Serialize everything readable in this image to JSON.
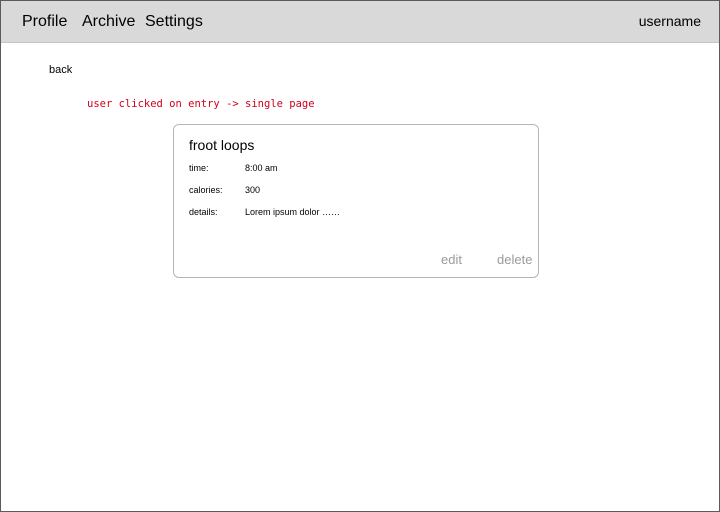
{
  "nav": {
    "profile": "Profile",
    "archive": "Archive",
    "settings": "Settings",
    "username": "username"
  },
  "back_label": "back",
  "annotation": "user clicked on entry -> single page",
  "entry": {
    "title": "froot loops",
    "fields": [
      {
        "label": "time:",
        "value": "8:00 am"
      },
      {
        "label": "calories:",
        "value": "300"
      },
      {
        "label": "details:",
        "value": "Lorem ipsum dolor ……"
      }
    ],
    "edit_label": "edit",
    "delete_label": "delete"
  },
  "colors": {
    "navbar_bg": "#d9d9d9",
    "annotation": "#d0021b",
    "action_text": "#9a9a9a",
    "card_border": "#b5b5b5"
  }
}
